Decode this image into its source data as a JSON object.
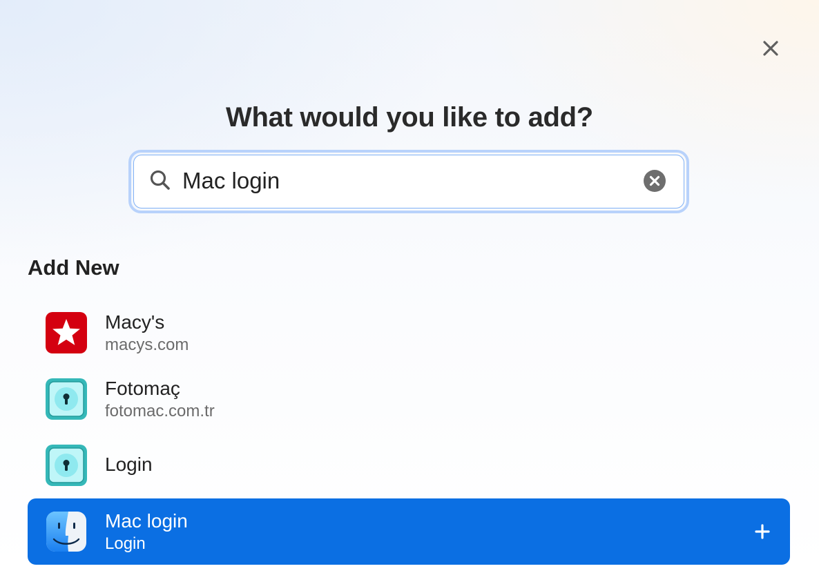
{
  "dialog": {
    "title": "What would you like to add?",
    "close_icon": "close-icon"
  },
  "search": {
    "value": "Mac login",
    "icon": "search-icon",
    "clear_icon": "clear-circle-icon"
  },
  "section": {
    "heading": "Add New"
  },
  "items": [
    {
      "title": "Macy's",
      "subtitle": "macys.com",
      "icon": "macys-star-icon",
      "selected": false
    },
    {
      "title": "Fotomaç",
      "subtitle": "fotomac.com.tr",
      "icon": "login-keyhole-icon",
      "selected": false
    },
    {
      "title": "Login",
      "subtitle": "",
      "icon": "login-keyhole-icon",
      "selected": false
    },
    {
      "title": "Mac login",
      "subtitle": "Login",
      "icon": "finder-icon",
      "selected": true,
      "action_icon": "plus-icon"
    }
  ],
  "colors": {
    "accent": "#0b6fe3",
    "focus_ring": "#b8d2fb",
    "macys_red": "#d40010",
    "login_teal": "#3bbcbc"
  }
}
